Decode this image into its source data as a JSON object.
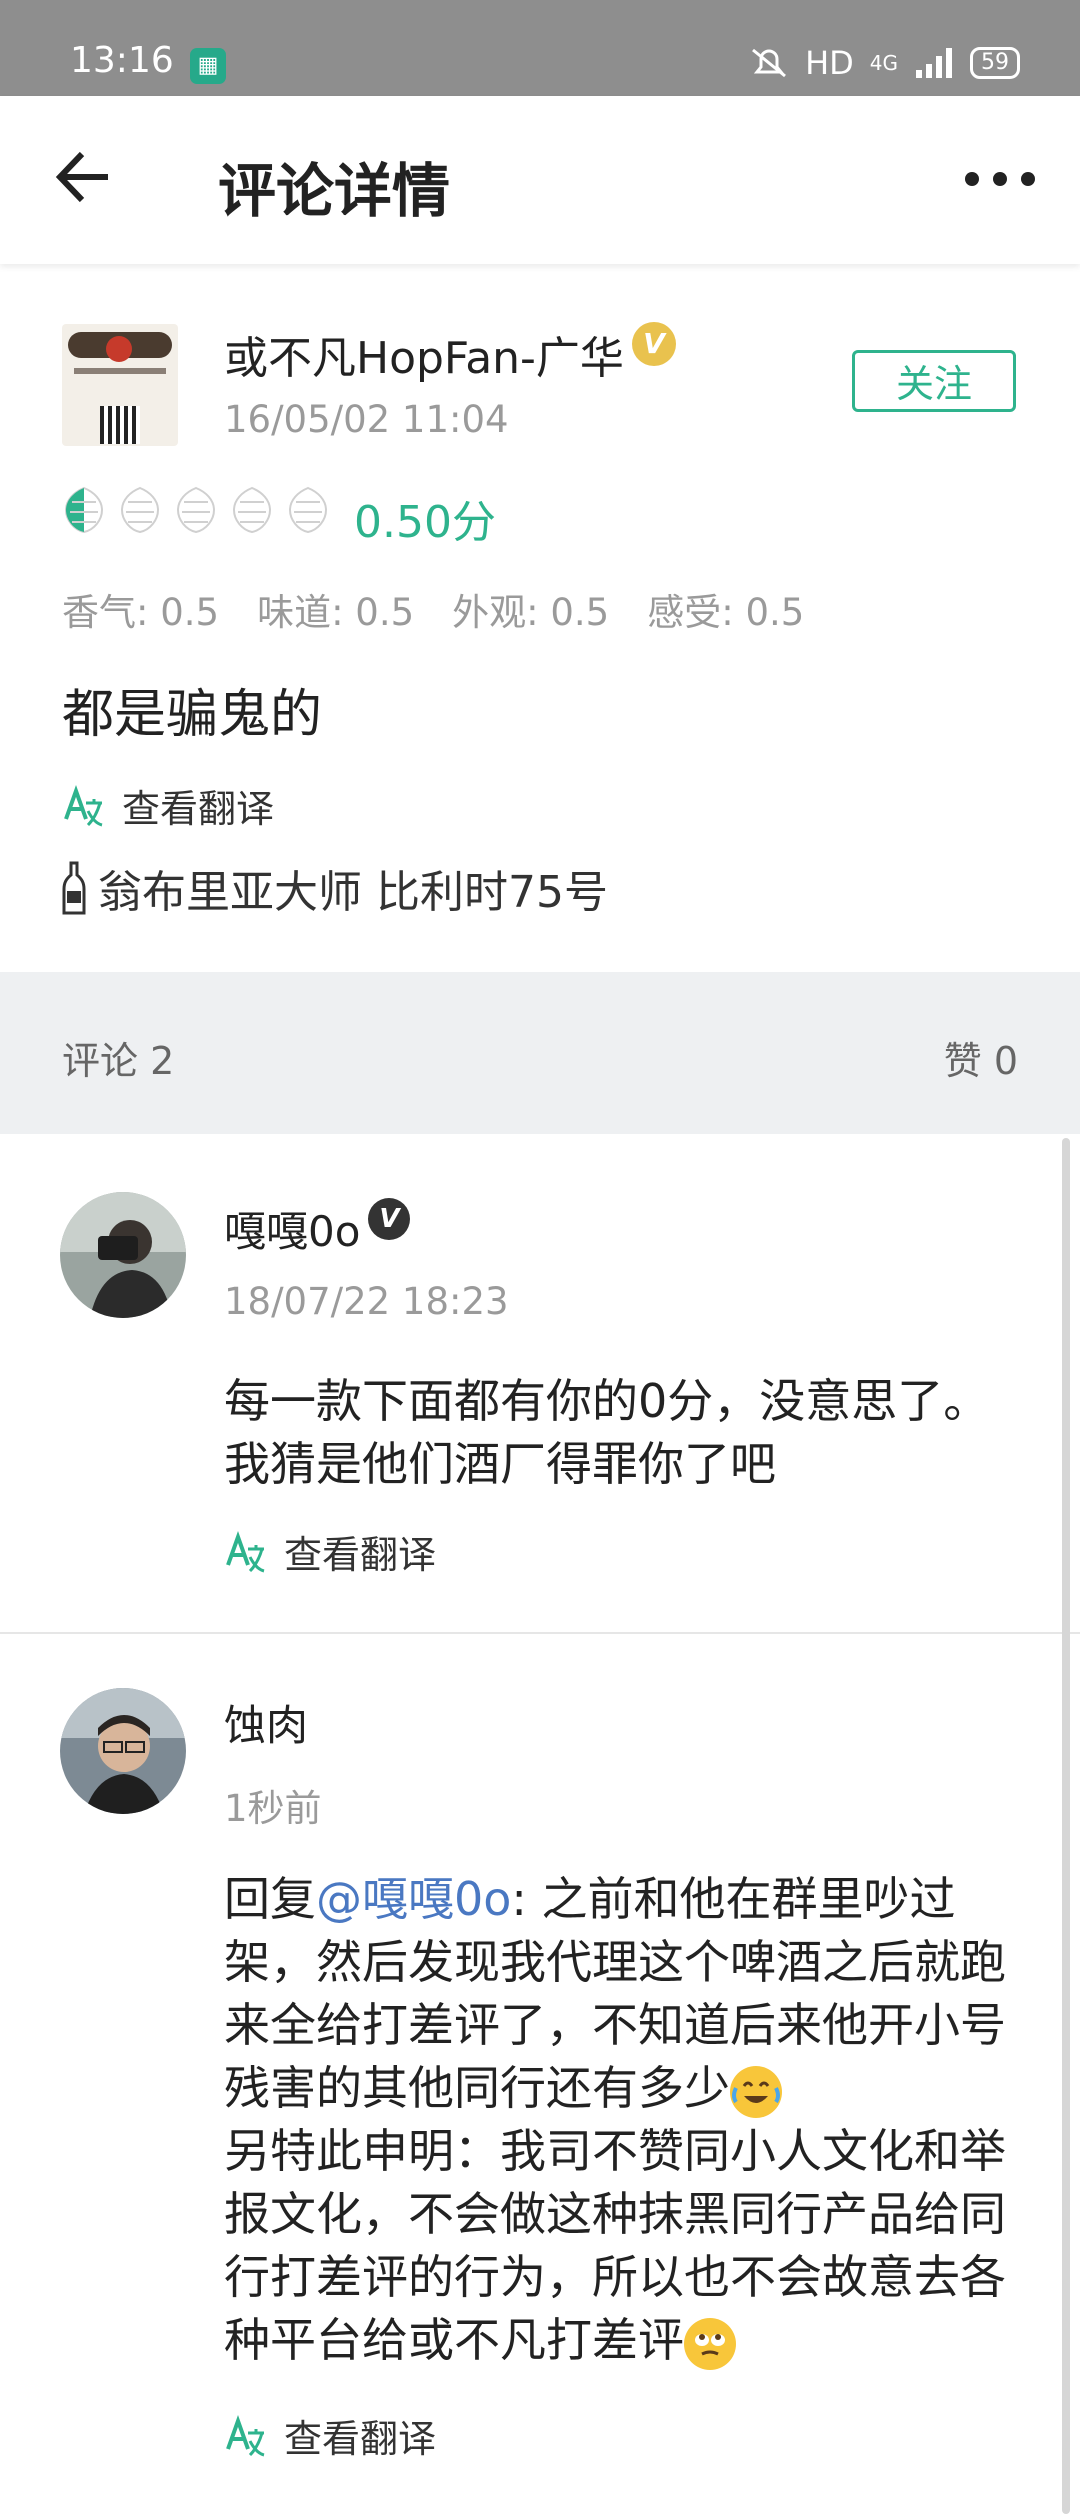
{
  "status_bar": {
    "time": "13:16",
    "network": "HD",
    "signal": "4G",
    "battery": "59"
  },
  "app_bar": {
    "title": "评论详情"
  },
  "review": {
    "user": "或不凡HopFan-广华",
    "verified_badge": "V",
    "time": "16/05/02 11:04",
    "follow_label": "关注",
    "rating": 0.5,
    "rating_max": 5,
    "score": "0.50分",
    "subscores": [
      "香气: 0.5",
      "味道: 0.5",
      "外观: 0.5",
      "感受: 0.5"
    ],
    "text": "都是骗鬼的",
    "translate_label": "查看翻译",
    "beer_name": "翁布里亚大师 比利时75号"
  },
  "counts": {
    "comments_label": "评论  2",
    "likes_label": "赞 0"
  },
  "comments": [
    {
      "user": "嘎嘎0o",
      "verified_badge": "V",
      "time": "18/07/22 18:23",
      "text_line1": "每一款下面都有你的0分，没意思了。",
      "text_line2": "我猜是他们酒厂得罪你了吧",
      "translate_label": "查看翻译"
    },
    {
      "user": "蚀肉",
      "time": "1秒前",
      "reply_prefix": "回复",
      "mention": "@嘎嘎0o",
      "text_part1": ": 之前和他在群里吵过架，然后发现我代理这个啤酒之后就跑来全给打差评了，不知道后来他开小号残害的其他同行还有多少",
      "text_part2": "另特此申明：我司不赞同小人文化和举报文化，不会做这种抹黑同行产品给同行打差评的行为，所以也不会故意去各种平台给或不凡打差评",
      "translate_label": "查看翻译"
    }
  ],
  "colors": {
    "accent": "#2eb38d",
    "mention": "#4a78c2",
    "badge_gold": "#e9c24e",
    "badge_dark": "#333333"
  },
  "icons": [
    "back-arrow-icon",
    "more-icon",
    "hop-icon",
    "translate-icon",
    "bottle-icon",
    "verified-icon",
    "laugh-cry-emoji-icon",
    "eye-roll-emoji-icon"
  ]
}
